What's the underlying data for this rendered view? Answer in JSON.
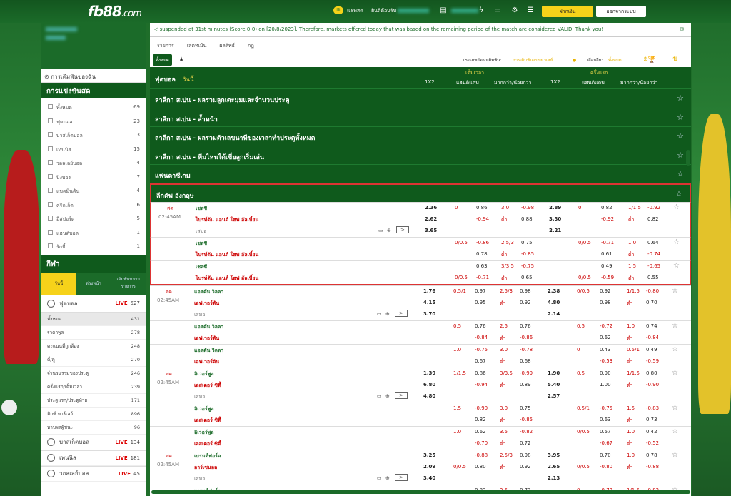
{
  "header": {
    "logo": "fb88",
    "logo_suffix": ".com",
    "chat_label": "แชทสด",
    "welcome": "ยินดีต้อนรับ",
    "deposit": "ฝากเงิน",
    "logout": "ออกจากระบบ"
  },
  "sidebar": {
    "fav": "การเดิมพันของฉัน",
    "sports_title": "การแข่งขันสด",
    "sports": [
      {
        "l": "ทั้งหมด",
        "n": "69"
      },
      {
        "l": "ฟุตบอล",
        "n": "23"
      },
      {
        "l": "บาสเก็ตบอล",
        "n": "3"
      },
      {
        "l": "เทนนิส",
        "n": "15"
      },
      {
        "l": "วอลเลย์บอล",
        "n": "4"
      },
      {
        "l": "ปิงปอง",
        "n": "7"
      },
      {
        "l": "แบดมินตัน",
        "n": "4"
      },
      {
        "l": "คริกเก็ต",
        "n": "6"
      },
      {
        "l": "อีสปอร์ต",
        "n": "5"
      },
      {
        "l": "แฮนด์บอล",
        "n": "1"
      },
      {
        "l": "รักบี้",
        "n": "1"
      }
    ],
    "sport_title": "กีฬา",
    "tabs": [
      "วันนี้",
      "ล่วงหน้า",
      "เดิมพันหลายรายการ"
    ],
    "football": {
      "l": "ฟุตบอล",
      "live": "LIVE",
      "n": "527"
    },
    "markets": [
      {
        "l": "ทั้งหมด",
        "n": "431"
      },
      {
        "l": "ราคาพูล",
        "n": "278"
      },
      {
        "l": "คะแนนที่ถูกต้อง",
        "n": "248"
      },
      {
        "l": "คี่/คู่",
        "n": "270"
      },
      {
        "l": "จำนวนรวมของประตู",
        "n": "246"
      },
      {
        "l": "ครึ่งแรก/เต็มเวลา",
        "n": "239"
      },
      {
        "l": "ประตูแรก/ประตูท้าย",
        "n": "171"
      },
      {
        "l": "มิกซ์ พาร์เลย์",
        "n": "896"
      },
      {
        "l": "หาบผลผู้ชนะ",
        "n": "96"
      }
    ],
    "others": [
      {
        "l": "บาสเก็ตบอล",
        "live": "LIVE",
        "n": "134"
      },
      {
        "l": "เทนนิส",
        "live": "LIVE",
        "n": "181"
      },
      {
        "l": "วอลเลย์บอล",
        "live": "LIVE",
        "n": "45"
      }
    ]
  },
  "main": {
    "notice": "suspended at 31st minutes (Score 0-0) on [20/8/2023]. Therefore, markets offered today that was based on the remaining period of the match are considered VALID. Thank you!",
    "tabs": [
      "รายการ",
      "เสตทเม้น",
      "ผลลัพธ์",
      "กฎ"
    ],
    "filter": {
      "all": "ทั้งหมด",
      "bet_type_label": "ประเภทอัตราเดิมพัน:",
      "bet_type": "การเดิมพันแบบมาเลย์",
      "league_label": "เลือกลีก:",
      "league": "ทั้งหมด"
    },
    "header": {
      "title": "ฟุตบอล",
      "title2": "วันนี้",
      "full": "เต็มเวลา",
      "half": "ครึ่งแรก",
      "c1": "1X2",
      "c2": "แฮนดิแคป",
      "c3": "มากกว่า/น้อยกว่า"
    },
    "leagues": [
      "ลาลีกา สเปน - ผลรวมลูกเตะมุมและจำนวนประตู",
      "ลาลีกา สเปน - ล้ำหน้า",
      "ลาลีกา สเปน - ผลรวมตัวเลขนาทีของเวลาทำประตูทั้งหมด",
      "ลาลีกา สเปน - ทีมไหนได้เขี่ยลูกเริ่มเล่น",
      "แฟนตาซีเกม",
      "ลีกคัพ อังกฤษ"
    ],
    "live": "สด",
    "time": "02:45AM",
    "draw": "เสมอ",
    "over": "ต่ำ",
    "m1": {
      "h": "เชลซี",
      "a": "ไบรท์ตัน แอนด์ โฮฟ อัลเบี้ยน"
    },
    "m2": {
      "h": "แอสตัน วิลลา",
      "a": "เอฟเวอร์ตัน"
    },
    "m3": {
      "h": "ลิเวอร์พูล",
      "a": "เลสเตอร์ ซิตี้"
    },
    "m4": {
      "h": "เบรนท์ฟอร์ด",
      "a": "อาร์เซนอล"
    }
  }
}
